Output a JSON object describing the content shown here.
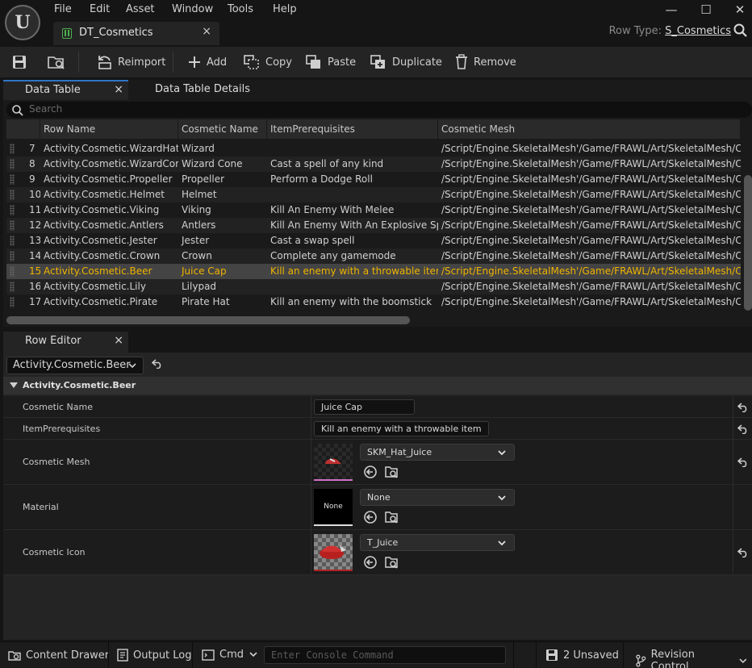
{
  "menu": [
    "File",
    "Edit",
    "Asset",
    "Window",
    "Tools",
    "Help"
  ],
  "window": {
    "minimize": "—",
    "maximize": "☐",
    "close": "✕"
  },
  "doc_tab": {
    "title": "DT_Cosmetics",
    "close": "×"
  },
  "row_type": {
    "label": "Row Type:",
    "value": "S_Cosmetics"
  },
  "toolbar": {
    "reimport": "Reimport",
    "add": "Add",
    "copy": "Copy",
    "paste": "Paste",
    "duplicate": "Duplicate",
    "remove": "Remove"
  },
  "panel_tabs": {
    "data_table": "Data Table",
    "details": "Data Table Details",
    "close": "×"
  },
  "search": {
    "placeholder": "Search"
  },
  "table": {
    "columns": [
      "Row Name",
      "Cosmetic Name",
      "ItemPrerequisites",
      "Cosmetic Mesh"
    ],
    "rows": [
      {
        "num": "7",
        "name": "Activity.Cosmetic.WizardHat",
        "cosmetic": "Wizard",
        "prereq": "",
        "mesh": "/Script/Engine.SkeletalMesh'/Game/FRAWL/Art/SkeletalMesh/Cosmetics"
      },
      {
        "num": "8",
        "name": "Activity.Cosmetic.WizardCone",
        "cosmetic": "Wizard Cone",
        "prereq": "Cast a spell of any kind",
        "mesh": "/Script/Engine.SkeletalMesh'/Game/FRAWL/Art/SkeletalMesh/Cosmetics"
      },
      {
        "num": "9",
        "name": "Activity.Cosmetic.Propeller",
        "cosmetic": "Propeller",
        "prereq": "Perform a Dodge Roll",
        "mesh": "/Script/Engine.SkeletalMesh'/Game/FRAWL/Art/SkeletalMesh/Cosmetics"
      },
      {
        "num": "10",
        "name": "Activity.Cosmetic.Helmet",
        "cosmetic": "Helmet",
        "prereq": "",
        "mesh": "/Script/Engine.SkeletalMesh'/Game/FRAWL/Art/SkeletalMesh/Cosmetics"
      },
      {
        "num": "11",
        "name": "Activity.Cosmetic.Viking",
        "cosmetic": "Viking",
        "prereq": "Kill An Enemy With Melee",
        "mesh": "/Script/Engine.SkeletalMesh'/Game/FRAWL/Art/SkeletalMesh/Cosmetics"
      },
      {
        "num": "12",
        "name": "Activity.Cosmetic.Antlers",
        "cosmetic": "Antlers",
        "prereq": "Kill An Enemy With An Explosive Spell",
        "mesh": "/Script/Engine.SkeletalMesh'/Game/FRAWL/Art/SkeletalMesh/Cosmetics"
      },
      {
        "num": "13",
        "name": "Activity.Cosmetic.Jester",
        "cosmetic": "Jester",
        "prereq": "Cast a swap spell",
        "mesh": "/Script/Engine.SkeletalMesh'/Game/FRAWL/Art/SkeletalMesh/Cosmetics"
      },
      {
        "num": "14",
        "name": "Activity.Cosmetic.Crown",
        "cosmetic": "Crown",
        "prereq": "Complete any gamemode",
        "mesh": "/Script/Engine.SkeletalMesh'/Game/FRAWL/Art/SkeletalMesh/Cosmetics"
      },
      {
        "num": "15",
        "name": "Activity.Cosmetic.Beer",
        "cosmetic": "Juice Cap",
        "prereq": "Kill an enemy with a throwable item",
        "mesh": "/Script/Engine.SkeletalMesh'/Game/FRAWL/Art/SkeletalMesh/Cosmetics",
        "selected": true
      },
      {
        "num": "16",
        "name": "Activity.Cosmetic.Lily",
        "cosmetic": "Lilypad",
        "prereq": "",
        "mesh": "/Script/Engine.SkeletalMesh'/Game/FRAWL/Art/SkeletalMesh/Cosmetics"
      },
      {
        "num": "17",
        "name": "Activity.Cosmetic.Pirate",
        "cosmetic": "Pirate Hat",
        "prereq": "Kill an enemy with the boomstick",
        "mesh": "/Script/Engine.SkeletalMesh'/Game/FRAWL/Art/SkeletalMesh/Cosmetics"
      }
    ]
  },
  "row_editor": {
    "tab": "Row Editor",
    "close": "×",
    "selected_row": "Activity.Cosmetic.Beer",
    "category": "Activity.Cosmetic.Beer",
    "props": {
      "cosmetic_name": {
        "label": "Cosmetic Name",
        "value": "Juice Cap"
      },
      "prereq": {
        "label": "ItemPrerequisites",
        "value": "Kill an enemy with a throwable item"
      },
      "mesh": {
        "label": "Cosmetic Mesh",
        "value": "SKM_Hat_Juice"
      },
      "material": {
        "label": "Material",
        "value": "None",
        "thumb_text": "None"
      },
      "icon": {
        "label": "Cosmetic Icon",
        "value": "T_Juice"
      }
    }
  },
  "status": {
    "content_drawer": "Content Drawer",
    "output_log": "Output Log",
    "cmd": "Cmd",
    "console_placeholder": "Enter Console Command",
    "unsaved": "2 Unsaved",
    "revision": "Revision Control"
  },
  "colors": {
    "accent": "#2f75c8",
    "selected_text": "#f0b400",
    "datatable_icon": "#4caf50"
  }
}
